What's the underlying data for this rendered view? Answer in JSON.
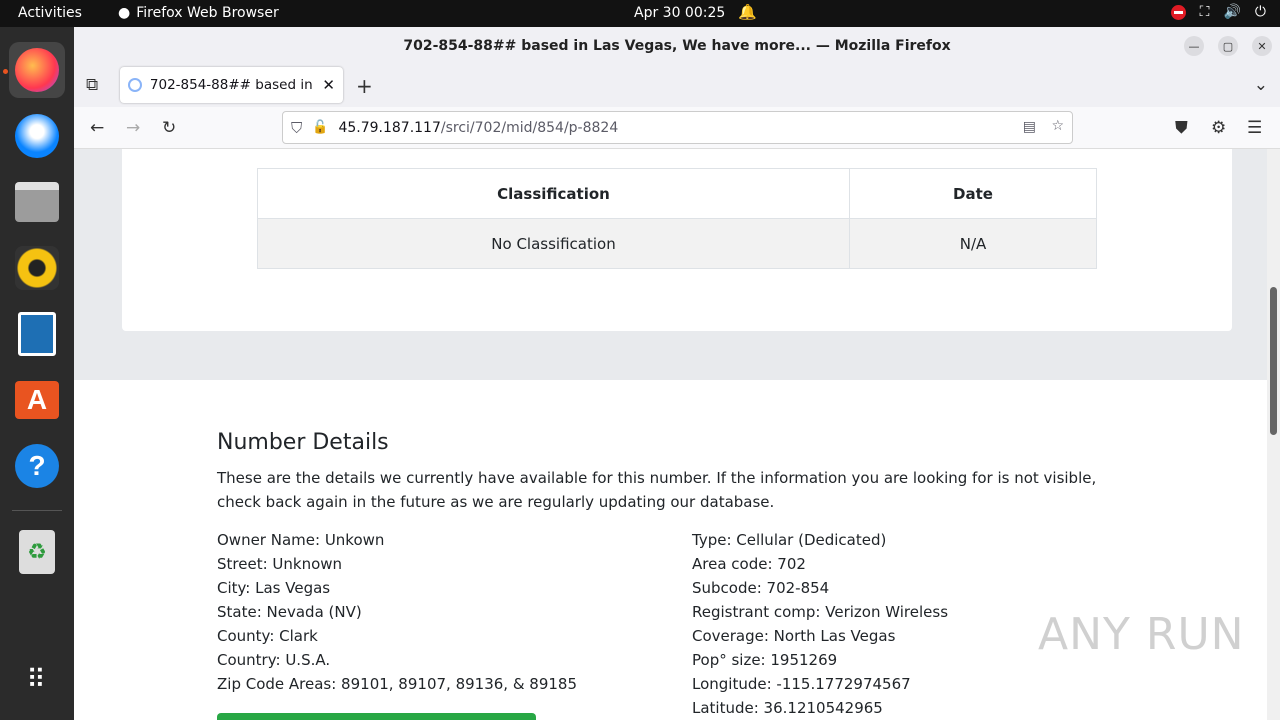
{
  "topbar": {
    "activities": "Activities",
    "app_name": "Firefox Web Browser",
    "clock": "Apr 30  00:25"
  },
  "window": {
    "title": "702-854-88## based in Las Vegas, We have more... — Mozilla Firefox"
  },
  "tab": {
    "title": "702-854-88## based in Las Vegas"
  },
  "url": {
    "host": "45.79.187.117",
    "path": "/srci/702/mid/854/p-8824"
  },
  "classification_table": {
    "headers": [
      "Classification",
      "Date"
    ],
    "rows": [
      [
        "No Classification",
        "N/A"
      ]
    ]
  },
  "number_details": {
    "heading": "Number Details",
    "intro": "These are the details we currently have available for this number. If the information you are looking for is not visible, check back again in the future as we are regularly updating our database.",
    "left": [
      "Owner Name: Unkown",
      "Street: Unknown",
      "City: Las Vegas",
      "State: Nevada (NV)",
      "County: Clark",
      "Country: U.S.A.",
      "Zip Code Areas: 89101, 89107, 89136, & 89185"
    ],
    "right": [
      "Type: Cellular (Dedicated)",
      "Area code: 702",
      "Subcode: 702-854",
      "Registrant comp: Verizon Wireless",
      "Coverage: North Las Vegas",
      "Pop° size: 1951269",
      "Longitude: -115.1772974567",
      "Latitude: 36.1210542965"
    ]
  },
  "watermark": "ANY RUN"
}
